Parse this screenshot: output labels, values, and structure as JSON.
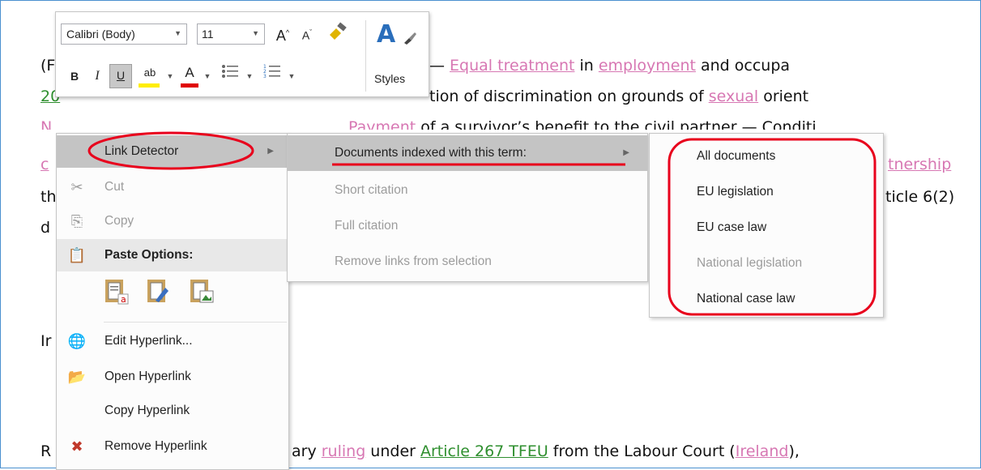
{
  "document": {
    "line1": {
      "prefix": "(F",
      "dash": " — ",
      "link1": "Equal treatment",
      "mid1": " in ",
      "link2": "employment",
      "tail": " and occupa"
    },
    "line2": {
      "prefix": "20",
      "text": "tion of discrimination on grounds of ",
      "link": "sexual",
      "tail": " orient"
    },
    "line3": {
      "prefix": "N",
      "link": "Payment",
      "text": " of a survivor’s benefit to the civil partner — Conditi"
    },
    "line4": {
      "prefix": "c",
      "link": "tnership"
    },
    "line5": {
      "prefix": "th",
      "text": "ticle 6(2)"
    },
    "line6": {
      "prefix": "d"
    },
    "line7": {
      "prefix": "Ir"
    },
    "line8": {
      "prefix": "R",
      "text1": "ary ",
      "link1": "ruling",
      "text2": " under ",
      "link2": "Article 267 TFEU",
      "text3": " from the Labour Court (",
      "link3": "Ireland",
      "text4": "),"
    }
  },
  "mini_toolbar": {
    "font_name": "Calibri (Body)",
    "font_size": "11",
    "grow_font": "A",
    "shrink_font": "A",
    "bold": "B",
    "italic": "I",
    "underline": "U",
    "highlight": "ab",
    "font_color": "A",
    "styles_label": "Styles",
    "styles_glyph": "A"
  },
  "context_menu": {
    "link_detector": "Link Detector",
    "cut": "Cut",
    "copy": "Copy",
    "paste_options": "Paste Options:",
    "edit_hyperlink": "Edit Hyperlink...",
    "open_hyperlink": "Open Hyperlink",
    "copy_hyperlink": "Copy Hyperlink",
    "remove_hyperlink": "Remove Hyperlink"
  },
  "submenu_link_detector": {
    "documents_indexed": "Documents indexed with this term:",
    "short_citation": "Short citation",
    "full_citation": "Full citation",
    "remove_links": "Remove links from selection"
  },
  "submenu_documents": {
    "items": [
      "All documents",
      "EU legislation",
      "EU case law",
      "National legislation",
      "National case law"
    ]
  },
  "colors": {
    "link_pink": "#d777b3",
    "link_green": "#2f8f2f",
    "annotation_red": "#e8001c",
    "menu_highlight": "#c4c4c4",
    "frame_blue": "#4a90d0"
  }
}
